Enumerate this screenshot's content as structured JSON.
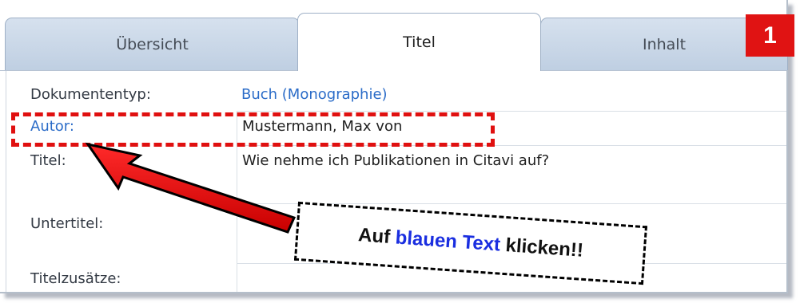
{
  "tabs": [
    {
      "label": "Übersicht",
      "active": false
    },
    {
      "label": "Titel",
      "active": true
    },
    {
      "label": "Inhalt",
      "active": false
    }
  ],
  "step_badge": "1",
  "fields": {
    "dokumententyp": {
      "label": "Dokumententyp:",
      "value": "Buch (Monographie)"
    },
    "autor": {
      "label": "Autor:",
      "value": "Mustermann, Max von"
    },
    "titel": {
      "label": "Titel:",
      "value": "Wie nehme ich Publikationen in Citavi auf?"
    },
    "untertitel": {
      "label": "Untertitel:",
      "value": ""
    },
    "titelzusaetze": {
      "label": "Titelzusätze:",
      "value": ""
    }
  },
  "callout": {
    "part1": "Auf ",
    "part2": "blauen Text",
    "part3": " klicken!!"
  },
  "colors": {
    "link_blue": "#2b6cc8",
    "highlight_red": "#e01010",
    "callout_blue": "#1a2ee0"
  }
}
